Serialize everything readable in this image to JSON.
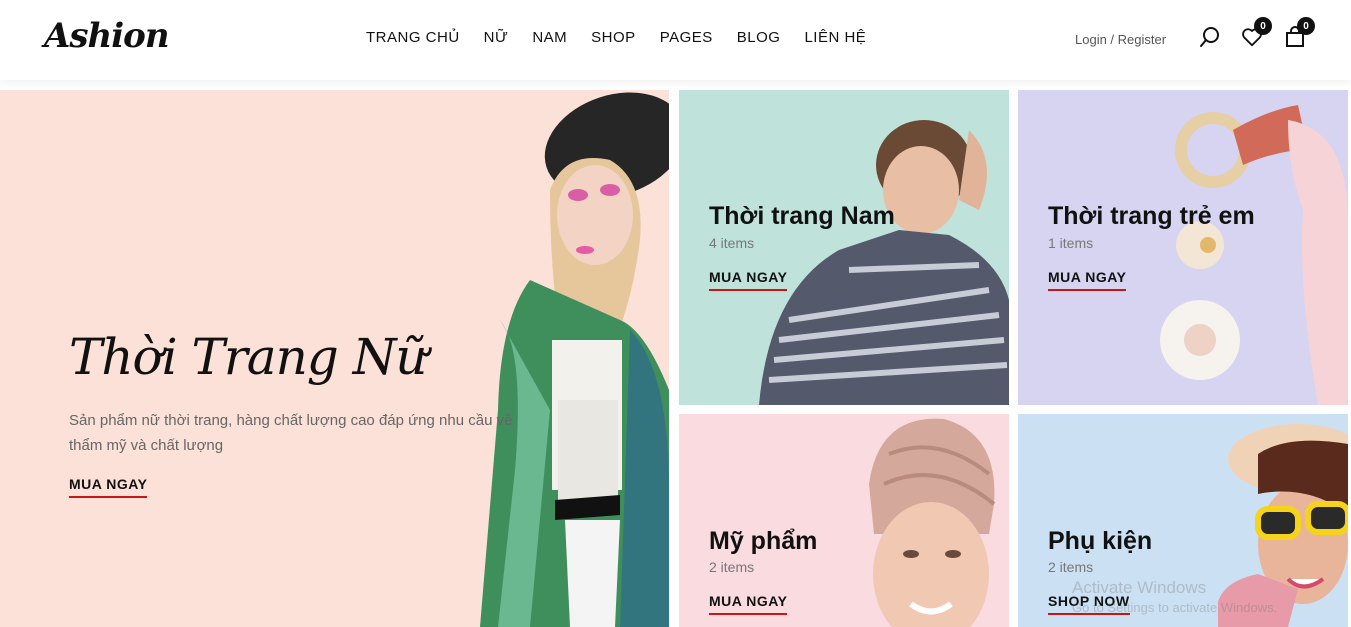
{
  "brand": {
    "logo_text": "Ashion"
  },
  "nav": {
    "items": [
      {
        "label": "TRANG CHỦ"
      },
      {
        "label": "NỮ"
      },
      {
        "label": "NAM"
      },
      {
        "label": "SHOP"
      },
      {
        "label": "PAGES"
      },
      {
        "label": "BLOG"
      },
      {
        "label": "LIÊN HỆ"
      }
    ]
  },
  "account": {
    "login": "Login",
    "separator": " / ",
    "register": "Register"
  },
  "header_icons": {
    "search": "search-icon",
    "wishlist": "heart-icon",
    "wishlist_count": "0",
    "cart": "shopping-bag-icon",
    "cart_count": "0"
  },
  "hero": {
    "title": "Thời Trang Nữ",
    "description": "Sản phẩm nữ thời trang, hàng chất lượng cao đáp ứng nhu cầu về thẩm mỹ và chất lượng",
    "cta": "MUA NGAY",
    "bg_color": "#fbe1d7"
  },
  "categories": [
    {
      "title": "Thời trang Nam",
      "count": "4 items",
      "cta": "MUA NGAY",
      "bg_color": "#bfe3da"
    },
    {
      "title": "Thời trang trẻ em",
      "count": "1 items",
      "cta": "MUA NGAY",
      "bg_color": "#d6d4f0"
    },
    {
      "title": "Mỹ phẩm",
      "count": "2 items",
      "cta": "MUA NGAY",
      "bg_color": "#fadbe0"
    },
    {
      "title": "Phụ kiện",
      "count": "2 items",
      "cta": "SHOP NOW",
      "bg_color": "#cbe0f3"
    }
  ],
  "theme": {
    "accent": "#ca1515",
    "text": "#111111"
  },
  "os_overlay": {
    "line1": "Activate Windows",
    "line2": "Go to Settings to activate Windows."
  }
}
